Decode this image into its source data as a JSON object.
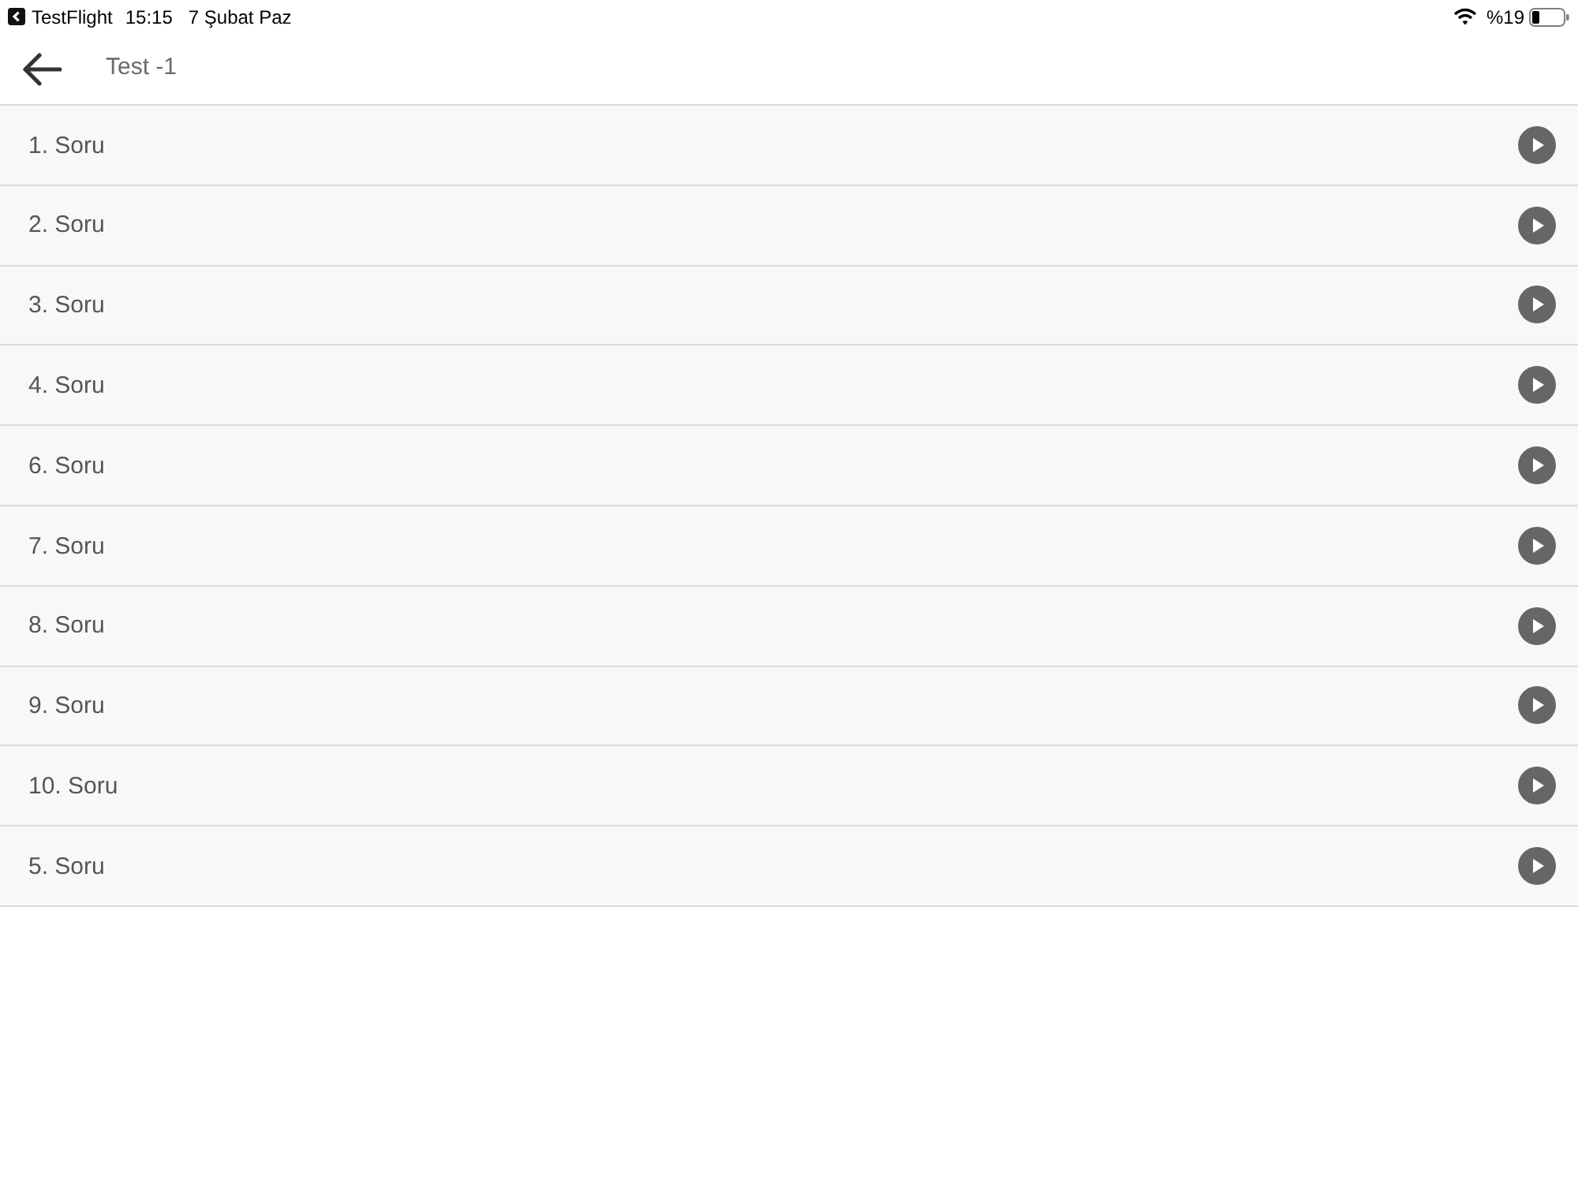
{
  "status_bar": {
    "back_app": "TestFlight",
    "time": "15:15",
    "date": "7 Şubat Paz",
    "battery": "%19"
  },
  "header": {
    "title": "Test -1"
  },
  "questions": [
    {
      "label": "1. Soru"
    },
    {
      "label": "2. Soru"
    },
    {
      "label": "3. Soru"
    },
    {
      "label": "4. Soru"
    },
    {
      "label": "6. Soru"
    },
    {
      "label": "7. Soru"
    },
    {
      "label": "8. Soru"
    },
    {
      "label": "9. Soru"
    },
    {
      "label": "10. Soru"
    },
    {
      "label": "5. Soru"
    }
  ]
}
